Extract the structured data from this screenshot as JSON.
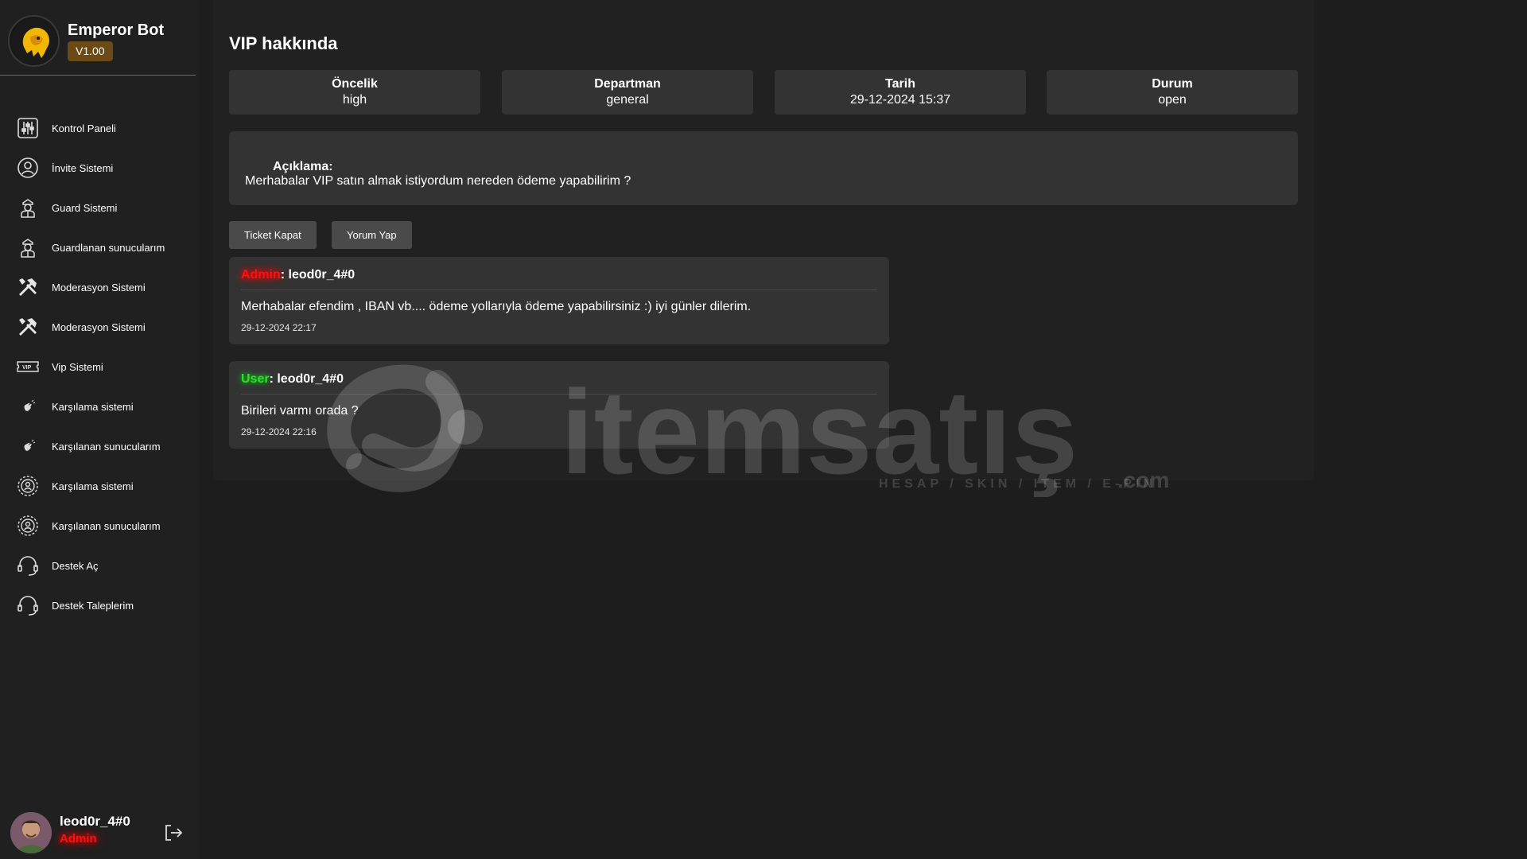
{
  "brand": {
    "name": "Emperor Bot",
    "version": "V1.00"
  },
  "nav": {
    "items": [
      {
        "label": "Kontrol Paneli",
        "icon": "control-panel-icon"
      },
      {
        "label": "İnvite Sistemi",
        "icon": "user-circle-icon"
      },
      {
        "label": "Guard Sistemi",
        "icon": "guard-icon"
      },
      {
        "label": "Guardlanan sunucularım",
        "icon": "guard-icon"
      },
      {
        "label": "Moderasyon Sistemi",
        "icon": "tools-icon"
      },
      {
        "label": "Moderasyon Sistemi",
        "icon": "tools-icon"
      },
      {
        "label": "Vip Sistemi",
        "icon": "vip-ticket-icon"
      },
      {
        "label": "Karşılama sistemi",
        "icon": "wave-hand-icon"
      },
      {
        "label": "Karşılanan sunucularım",
        "icon": "wave-hand-icon"
      },
      {
        "label": "Karşılama sistemi",
        "icon": "gear-badge-icon"
      },
      {
        "label": "Karşılanan sunucularım",
        "icon": "gear-badge-icon"
      },
      {
        "label": "Destek Aç",
        "icon": "headset-icon"
      },
      {
        "label": "Destek Taleplerim",
        "icon": "headset-icon"
      }
    ]
  },
  "user": {
    "name": "leod0r_4#0",
    "role": "Admin"
  },
  "ticket": {
    "title": "VIP hakkında",
    "info": [
      {
        "label": "Öncelik",
        "value": "high"
      },
      {
        "label": "Departman",
        "value": "general"
      },
      {
        "label": "Tarih",
        "value": "29-12-2024 15:37"
      },
      {
        "label": "Durum",
        "value": "open"
      }
    ],
    "description_label": "Açıklama:",
    "description": "Merhabalar VIP satın almak istiyordum nereden ödeme yapabilirim ?",
    "close_button": "Ticket Kapat",
    "comment_button": "Yorum Yap"
  },
  "comments": [
    {
      "role": "Admin",
      "author": ": leod0r_4#0",
      "text": "Merhabalar efendim , IBAN vb.... ödeme yollarıyla ödeme yapabilirsiniz :) iyi günler dilerim.",
      "date": "29-12-2024 22:17"
    },
    {
      "role": "User",
      "author": ": leod0r_4#0",
      "text": "Birileri varmı orada ?",
      "date": "29-12-2024 22:16"
    }
  ],
  "watermark": {
    "brand": "itemsatış",
    "tagline": "HESAP / SKIN / ITEM / E-PIN",
    "suffix": ".com"
  },
  "colors": {
    "admin": "#ff1010",
    "user": "#27e527",
    "version_badge": "#6b4a16",
    "card_bg": "#333333",
    "button_bg": "#4a4a4a"
  }
}
